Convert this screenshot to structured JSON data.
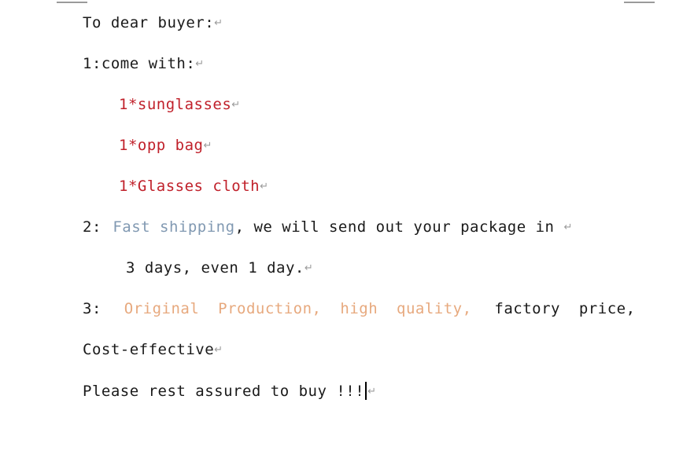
{
  "document": {
    "colors": {
      "text": "#1a1a1a",
      "red": "#c0202a",
      "blue": "#8199b2",
      "orange": "#e7a97e",
      "paragraph_mark": "#9b9b9b",
      "margin_marker": "#9a9a9a",
      "background": "#ffffff"
    },
    "paragraph_mark_glyph": "↵",
    "lines": {
      "greeting": "To dear buyer:",
      "item_heading": "1:come with:",
      "item_1": "1*sunglasses",
      "item_2": "1*opp bag",
      "item_3": "1*Glasses cloth",
      "point2_number": "2:",
      "point2_highlight": "Fast shipping",
      "point2_rest": ", we will send out your package in",
      "point2_cont": "3 days, even 1 day.",
      "point3_number": "3:",
      "point3_highlight": "Original  Production,  high  quality,",
      "point3_rest": "factory  price,",
      "point3_cont": "Cost-effective",
      "closing": "Please rest assured to buy !!!"
    }
  }
}
